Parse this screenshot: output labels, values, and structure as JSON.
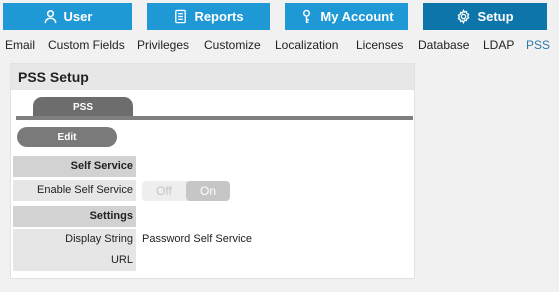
{
  "topnav": {
    "user": "User",
    "reports": "Reports",
    "my_account": "My Account",
    "setup": "Setup"
  },
  "submenu": [
    "Email",
    "Custom Fields",
    "Privileges",
    "Customize",
    "Localization",
    "Licenses",
    "Database",
    "LDAP",
    "PSS"
  ],
  "submenu_active": "PSS",
  "panel": {
    "title": "PSS Setup",
    "tab": "PSS",
    "edit": "Edit",
    "self_service_header": "Self Service",
    "enable_label": "Enable Self Service",
    "toggle_off": "Off",
    "toggle_on": "On",
    "settings_header": "Settings",
    "display_string_label": "Display String",
    "display_string_value": "Password Self Service",
    "url_label": "URL",
    "url_value": ""
  },
  "colors": {
    "nav": "#1e99d5",
    "nav_active": "#0d75a9",
    "submenu_active": "#2a7aa8"
  }
}
